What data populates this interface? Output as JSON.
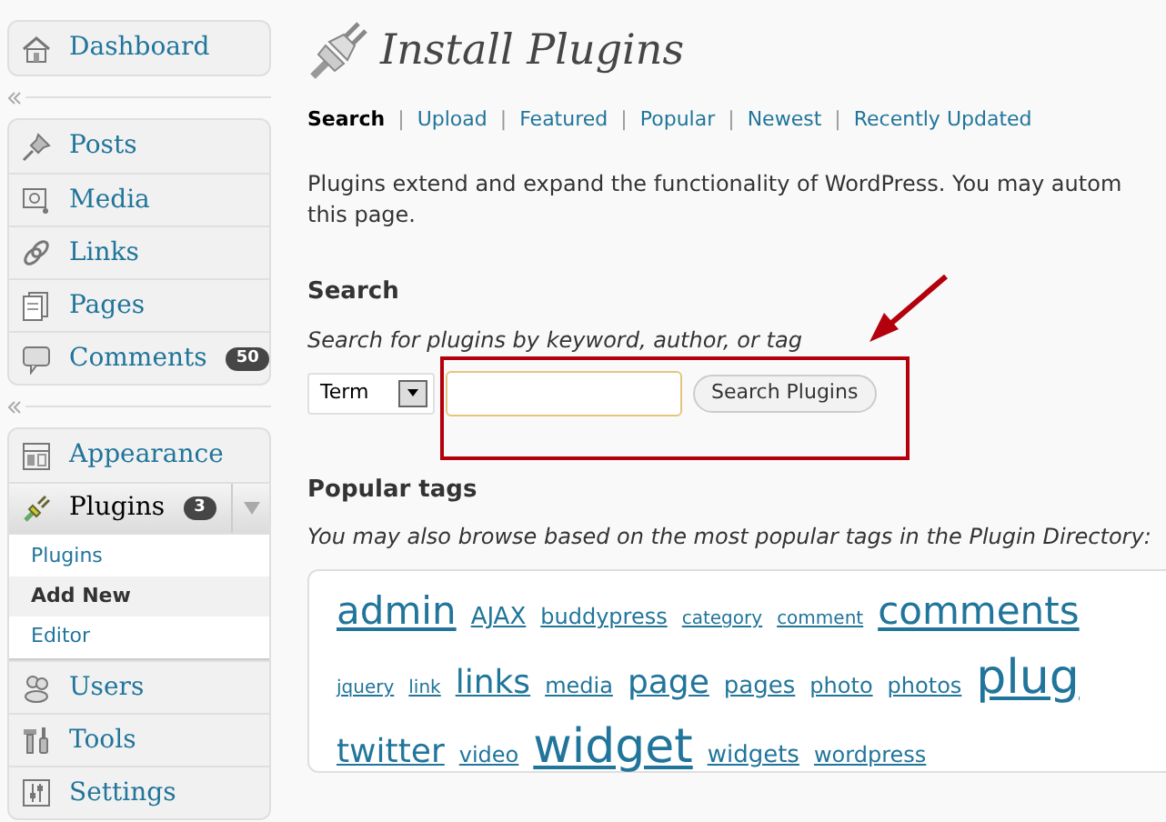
{
  "menu_groups": [
    {
      "items": [
        {
          "label": "Dashboard",
          "selected": false
        }
      ]
    },
    {
      "items": [
        {
          "label": "Posts",
          "selected": false
        },
        {
          "label": "Media",
          "selected": false
        },
        {
          "label": "Links",
          "selected": false
        },
        {
          "label": "Pages",
          "selected": false
        },
        {
          "label": "Comments",
          "selected": false,
          "badge": "50"
        }
      ]
    },
    {
      "items": [
        {
          "label": "Appearance",
          "selected": false
        },
        {
          "label": "Plugins",
          "selected": true,
          "expanded": true,
          "badge": "3",
          "children": [
            {
              "label": "Plugins",
              "selected": false
            },
            {
              "label": "Add New",
              "selected": true
            },
            {
              "label": "Editor",
              "selected": false
            }
          ]
        },
        {
          "label": "Users",
          "selected": false
        },
        {
          "label": "Tools",
          "selected": false
        },
        {
          "label": "Settings",
          "selected": false
        }
      ]
    }
  ],
  "page": {
    "title": "Install Plugins",
    "subnav": [
      {
        "label": "Search",
        "selected": true
      },
      {
        "label": "Upload",
        "selected": false
      },
      {
        "label": "Featured",
        "selected": false
      },
      {
        "label": "Popular",
        "selected": false
      },
      {
        "label": "Newest",
        "selected": false
      },
      {
        "label": "Recently Updated",
        "selected": false
      }
    ],
    "separator": "|",
    "intro_lines": [
      "Plugins extend and expand the functionality of WordPress. You may autom",
      "this page."
    ],
    "search": {
      "heading": "Search",
      "hint": "Search for plugins by keyword, author, or tag",
      "type_select": "Term",
      "button": "Search Plugins"
    },
    "tags": {
      "heading": "Popular tags",
      "hint": "You may also browse based on the most popular tags in the Plugin Directory:",
      "items": [
        {
          "label": "admin",
          "kind": "xl"
        },
        {
          "label": "AJAX",
          "kind": "m"
        },
        {
          "label": "buddypress",
          "kind": "s"
        },
        {
          "label": "category",
          "kind": "xs"
        },
        {
          "label": "comment",
          "kind": "xs"
        },
        {
          "label": "comments",
          "kind": "xl"
        },
        {
          "label": "jquery",
          "kind": "xs"
        },
        {
          "label": "link",
          "kind": "xs"
        },
        {
          "label": "links",
          "kind": "l"
        },
        {
          "label": "media",
          "kind": "s"
        },
        {
          "label": "page",
          "kind": "l"
        },
        {
          "label": "pages",
          "kind": "m"
        },
        {
          "label": "photo",
          "kind": "s"
        },
        {
          "label": "photos",
          "kind": "s"
        },
        {
          "label": "plug",
          "kind": "xxl"
        },
        {
          "label": "twitter",
          "kind": "l"
        },
        {
          "label": "video",
          "kind": "s"
        },
        {
          "label": "widget",
          "kind": "xxl"
        },
        {
          "label": "widgets",
          "kind": "m"
        },
        {
          "label": "wordpress",
          "kind": "s"
        }
      ]
    }
  }
}
